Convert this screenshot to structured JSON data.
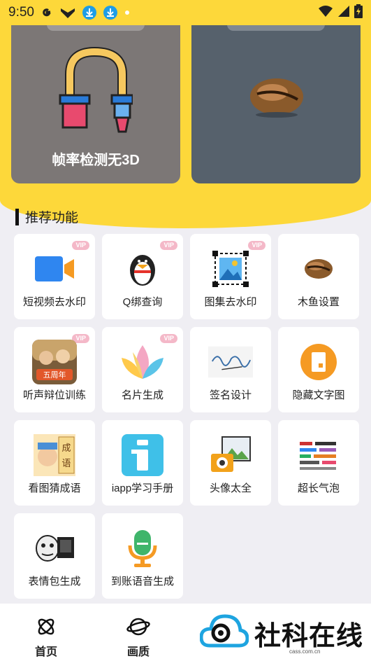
{
  "status_bar": {
    "time": "9:50",
    "icons": [
      "google-icon",
      "app-icon",
      "download-icon",
      "download-icon",
      "dot-icon",
      "wifi-icon",
      "signal-icon",
      "battery-icon"
    ]
  },
  "banner": {
    "cards": [
      {
        "title": "帧率检测无3D",
        "image": "paint-roller-icon"
      },
      {
        "title": "",
        "image": "wooden-fish-image"
      }
    ]
  },
  "section": {
    "title": "推荐功能"
  },
  "features": [
    {
      "label": "短视频去水印",
      "icon": "video-camera-icon",
      "vip": true
    },
    {
      "label": "Q绑查询",
      "icon": "penguin-icon",
      "vip": true
    },
    {
      "label": "图集去水印",
      "icon": "image-crop-icon",
      "vip": true
    },
    {
      "label": "木鱼设置",
      "icon": "wooden-fish-icon",
      "vip": false
    },
    {
      "label": "听声辩位训练",
      "icon": "game-icon",
      "vip": true
    },
    {
      "label": "名片生成",
      "icon": "petals-icon",
      "vip": true
    },
    {
      "label": "签名设计",
      "icon": "signature-icon",
      "vip": false
    },
    {
      "label": "隐藏文字图",
      "icon": "hidden-image-icon",
      "vip": false
    },
    {
      "label": "看图猜成语",
      "icon": "idiom-icon",
      "vip": false
    },
    {
      "label": "iapp学习手册",
      "icon": "info-icon",
      "vip": false
    },
    {
      "label": "头像太全",
      "icon": "avatar-camera-icon",
      "vip": false
    },
    {
      "label": "超长气泡",
      "icon": "bubble-icon",
      "vip": false
    },
    {
      "label": "表情包生成",
      "icon": "meme-icon",
      "vip": false
    },
    {
      "label": "到账语音生成",
      "icon": "microphone-icon",
      "vip": false
    }
  ],
  "vip_label": "VIP",
  "tabs": [
    {
      "label": "首页",
      "icon": "atom-icon"
    },
    {
      "label": "画质",
      "icon": "planet-icon"
    }
  ],
  "brand": {
    "name": "社科在线",
    "domain": "cass.com.cn"
  },
  "colors": {
    "accent": "#fdd83a",
    "background": "#efeef3"
  }
}
